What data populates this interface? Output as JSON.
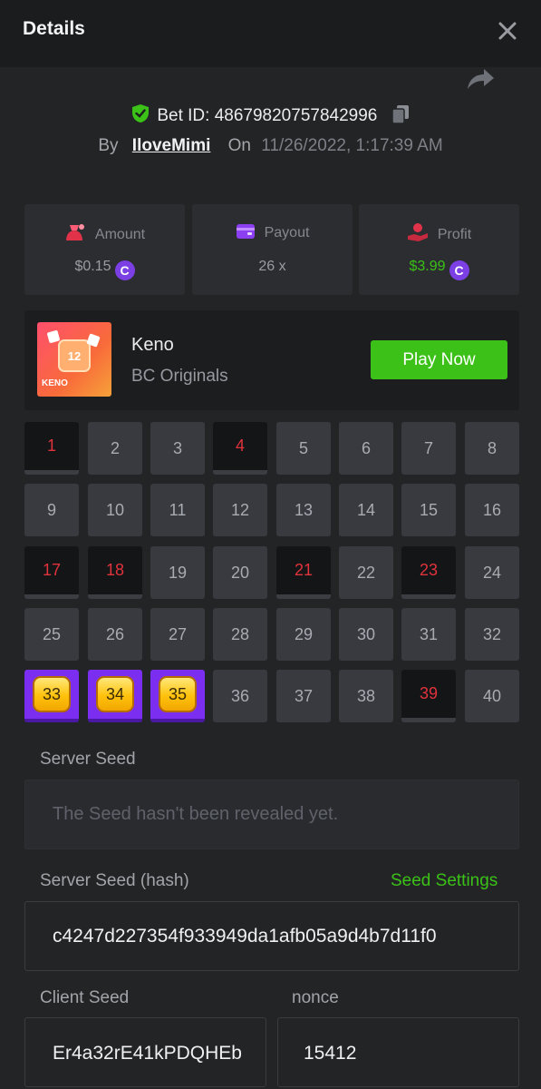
{
  "header": {
    "title": "Details"
  },
  "bet": {
    "label": "Bet ID:",
    "id": "48679820757842996",
    "by_label": "By",
    "user": "IloveMimi",
    "on_label": "On",
    "date": "11/26/2022, 1:17:39 AM"
  },
  "stats": {
    "amount_label": "Amount",
    "amount_value": "$0.15",
    "payout_label": "Payout",
    "payout_value": "26 x",
    "profit_label": "Profit",
    "profit_value": "$3.99",
    "coin_symbol": "C"
  },
  "game": {
    "name": "Keno",
    "provider": "BC Originals",
    "play_label": "Play Now",
    "thumb_text": "KENO",
    "thumb_number": "12"
  },
  "grid": {
    "cells": [
      {
        "n": "1",
        "state": "picked-miss"
      },
      {
        "n": "2",
        "state": "normal"
      },
      {
        "n": "3",
        "state": "normal"
      },
      {
        "n": "4",
        "state": "picked-miss"
      },
      {
        "n": "5",
        "state": "normal"
      },
      {
        "n": "6",
        "state": "normal"
      },
      {
        "n": "7",
        "state": "normal"
      },
      {
        "n": "8",
        "state": "normal"
      },
      {
        "n": "9",
        "state": "normal"
      },
      {
        "n": "10",
        "state": "normal"
      },
      {
        "n": "11",
        "state": "normal"
      },
      {
        "n": "12",
        "state": "normal"
      },
      {
        "n": "13",
        "state": "normal"
      },
      {
        "n": "14",
        "state": "normal"
      },
      {
        "n": "15",
        "state": "normal"
      },
      {
        "n": "16",
        "state": "normal"
      },
      {
        "n": "17",
        "state": "picked-miss"
      },
      {
        "n": "18",
        "state": "picked-miss"
      },
      {
        "n": "19",
        "state": "normal"
      },
      {
        "n": "20",
        "state": "normal"
      },
      {
        "n": "21",
        "state": "picked-miss"
      },
      {
        "n": "22",
        "state": "normal"
      },
      {
        "n": "23",
        "state": "picked-miss"
      },
      {
        "n": "24",
        "state": "normal"
      },
      {
        "n": "25",
        "state": "normal"
      },
      {
        "n": "26",
        "state": "normal"
      },
      {
        "n": "27",
        "state": "normal"
      },
      {
        "n": "28",
        "state": "normal"
      },
      {
        "n": "29",
        "state": "normal"
      },
      {
        "n": "30",
        "state": "normal"
      },
      {
        "n": "31",
        "state": "normal"
      },
      {
        "n": "32",
        "state": "normal"
      },
      {
        "n": "33",
        "state": "win"
      },
      {
        "n": "34",
        "state": "win"
      },
      {
        "n": "35",
        "state": "win"
      },
      {
        "n": "36",
        "state": "normal"
      },
      {
        "n": "37",
        "state": "normal"
      },
      {
        "n": "38",
        "state": "normal"
      },
      {
        "n": "39",
        "state": "picked-miss"
      },
      {
        "n": "40",
        "state": "normal"
      }
    ]
  },
  "seeds": {
    "server_seed_label": "Server Seed",
    "server_seed_value": "The Seed hasn't been revealed yet.",
    "server_hash_label": "Server Seed (hash)",
    "seed_settings_label": "Seed Settings",
    "server_hash_value": "c4247d227354f933949da1afb05a9d4b7d11f0",
    "client_seed_label": "Client Seed",
    "client_seed_value": "Er4a32rE41kPDQHEb",
    "nonce_label": "nonce",
    "nonce_value": "15412"
  },
  "colors": {
    "accent_green": "#3bc117",
    "miss_red": "#e0333c",
    "win_purple": "#7c2ef0",
    "coin_purple": "#7b3fe4"
  }
}
